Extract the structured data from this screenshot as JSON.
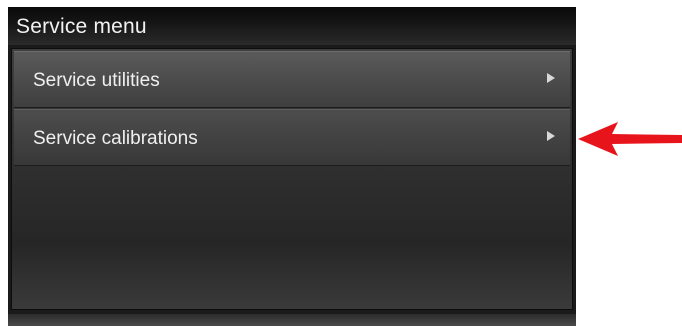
{
  "screen": {
    "title": "Service menu"
  },
  "menu": {
    "items": [
      {
        "label": "Service utilities",
        "icon": "chevron-right-icon"
      },
      {
        "label": "Service calibrations",
        "icon": "chevron-right-icon"
      }
    ]
  },
  "annotation": {
    "arrow_color": "#e8141b",
    "points_to": "Service calibrations"
  }
}
